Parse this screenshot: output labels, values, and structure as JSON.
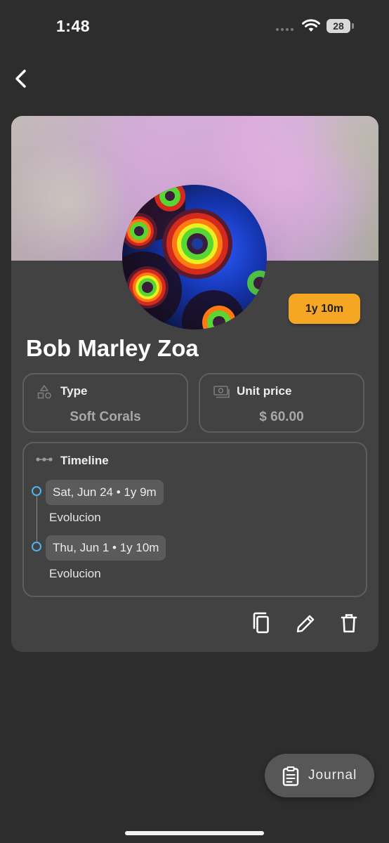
{
  "status_bar": {
    "time": "1:48",
    "battery": "28"
  },
  "navigation": {
    "back_icon": "chevron-left-icon"
  },
  "coral": {
    "age_badge": "1y 10m",
    "name": "Bob Marley Zoa",
    "type_label": "Type",
    "type_value": "Soft Corals",
    "price_label": "Unit price",
    "price_value": "$ 60.00"
  },
  "timeline": {
    "title": "Timeline",
    "entries": [
      {
        "date": "Sat, Jun 24 • 1y 9m",
        "note": "Evolucion"
      },
      {
        "date": "Thu, Jun 1 • 1y 10m",
        "note": "Evolucion"
      }
    ]
  },
  "actions": {
    "copy_icon": "copy-icon",
    "edit_icon": "pencil-icon",
    "delete_icon": "trash-icon"
  },
  "journal_button": {
    "label": "Journal",
    "icon": "clipboard-icon"
  },
  "colors": {
    "background": "#2d2d2d",
    "card": "#424242",
    "badge": "#f5a623",
    "timeline_dot": "#4fb3ea",
    "muted_text": "#a8a8a8"
  }
}
